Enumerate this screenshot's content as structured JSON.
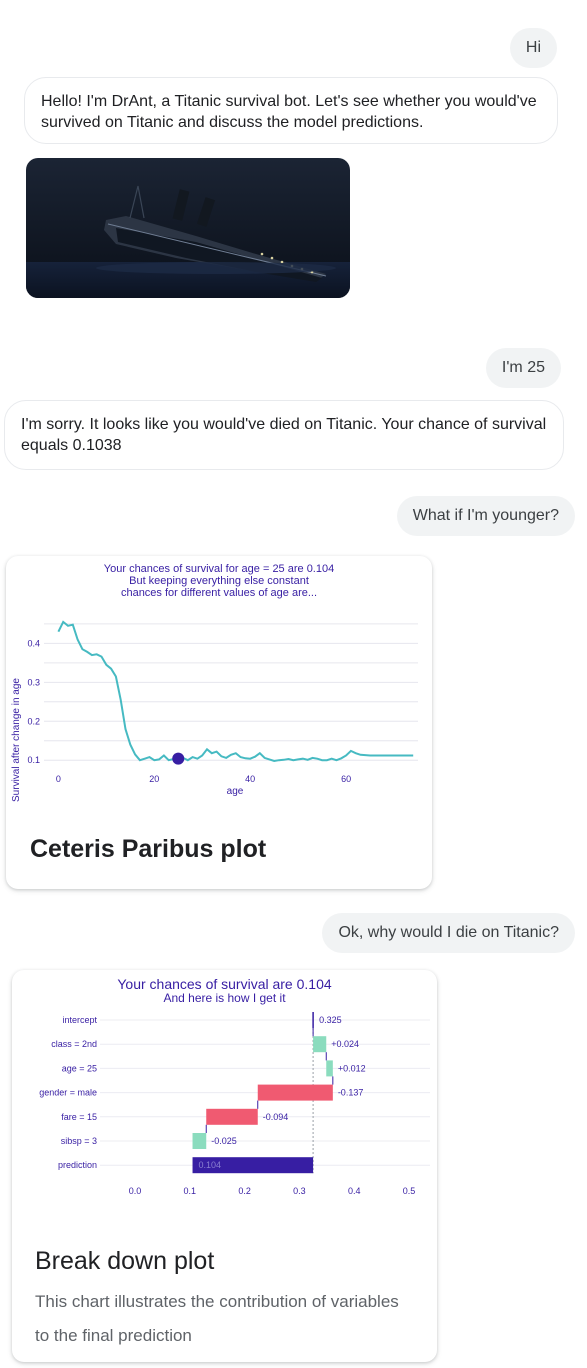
{
  "messages": {
    "user_1": "Hi",
    "bot_1": "Hello! I'm DrAnt, a Titanic survival bot. Let's see whether you would've survived on Titanic and discuss the model predictions.",
    "user_2": "I'm 25",
    "bot_2": "I'm sorry. It looks like you would've died on Titanic. Your chance of survival equals 0.1038",
    "user_3": "What if I'm younger?",
    "user_4": "Ok, why would I die on Titanic?"
  },
  "ceteris_paribus": {
    "card_title": "Ceteris Paribus plot",
    "chart_data": {
      "type": "line",
      "title_lines": [
        "Your chances of survival for age = 25 are 0.104",
        "But keeping everything else constant",
        "chances for different values of age are..."
      ],
      "xlabel": "age",
      "ylabel": "Survival after change in age",
      "x_ticks": [
        "0",
        "20",
        "40",
        "60"
      ],
      "y_ticks": [
        "0.1",
        "0.2",
        "0.3",
        "0.4"
      ],
      "xlim": [
        -3,
        75
      ],
      "ylim": [
        0.08,
        0.46
      ],
      "line_color": "#46bac2",
      "point_color": "#371ea3",
      "observation": {
        "x": 25,
        "y": 0.104
      },
      "x": [
        0,
        1,
        2,
        3,
        4,
        5,
        6,
        7,
        8,
        9,
        10,
        11,
        12,
        13,
        14,
        15,
        16,
        17,
        18,
        19,
        20,
        21,
        22,
        23,
        24,
        25,
        26,
        27,
        28,
        29,
        30,
        31,
        32,
        33,
        34,
        35,
        36,
        37,
        38,
        39,
        40,
        41,
        42,
        43,
        44,
        45,
        46,
        47,
        48,
        49,
        50,
        51,
        52,
        53,
        54,
        55,
        56,
        57,
        58,
        59,
        60,
        61,
        62,
        63,
        64,
        65,
        66,
        67,
        68,
        69,
        70,
        71,
        72,
        73,
        74
      ],
      "y": [
        0.43,
        0.455,
        0.445,
        0.448,
        0.41,
        0.385,
        0.378,
        0.37,
        0.372,
        0.366,
        0.345,
        0.335,
        0.315,
        0.255,
        0.18,
        0.14,
        0.115,
        0.1,
        0.104,
        0.108,
        0.1,
        0.102,
        0.112,
        0.1,
        0.103,
        0.104,
        0.106,
        0.1,
        0.108,
        0.104,
        0.112,
        0.128,
        0.118,
        0.122,
        0.11,
        0.106,
        0.114,
        0.118,
        0.108,
        0.105,
        0.104,
        0.109,
        0.118,
        0.106,
        0.102,
        0.098,
        0.1,
        0.101,
        0.103,
        0.1,
        0.102,
        0.104,
        0.101,
        0.106,
        0.104,
        0.1,
        0.1,
        0.104,
        0.1,
        0.105,
        0.112,
        0.124,
        0.118,
        0.114,
        0.113,
        0.112,
        0.112,
        0.112,
        0.112,
        0.112,
        0.112,
        0.112,
        0.112,
        0.112,
        0.112
      ]
    }
  },
  "break_down": {
    "card_title": "Break down plot",
    "caption": "This chart illustrates the contribution of variables to the final prediction",
    "chart_data": {
      "type": "bar",
      "title_lines": [
        "Your chances of survival are 0.104",
        "And here is how I get it"
      ],
      "x_ticks": [
        "0.0",
        "0.1",
        "0.2",
        "0.3",
        "0.4",
        "0.5"
      ],
      "xlim": [
        0,
        0.5
      ],
      "colors": {
        "positive": "#8bdcbe",
        "negative": "#f05a71",
        "prediction": "#371ea3",
        "intercept": "#371ea3"
      },
      "rows": [
        {
          "label": "intercept",
          "start": 0.325,
          "end": 0.325,
          "value_label": "0.325",
          "kind": "intercept"
        },
        {
          "label": "class = 2nd",
          "start": 0.325,
          "end": 0.349,
          "value_label": "+0.024",
          "kind": "positive"
        },
        {
          "label": "age = 25",
          "start": 0.349,
          "end": 0.361,
          "value_label": "+0.012",
          "kind": "positive"
        },
        {
          "label": "gender = male",
          "start": 0.361,
          "end": 0.224,
          "value_label": "-0.137",
          "kind": "negative"
        },
        {
          "label": "fare = 15",
          "start": 0.224,
          "end": 0.13,
          "value_label": "-0.094",
          "kind": "negative"
        },
        {
          "label": "sibsp = 3",
          "start": 0.13,
          "end": 0.105,
          "value_label": "-0.025",
          "kind": "positive"
        },
        {
          "label": "prediction",
          "start": 0.105,
          "end": 0.325,
          "value_label": "0.104",
          "kind": "prediction"
        }
      ]
    }
  }
}
